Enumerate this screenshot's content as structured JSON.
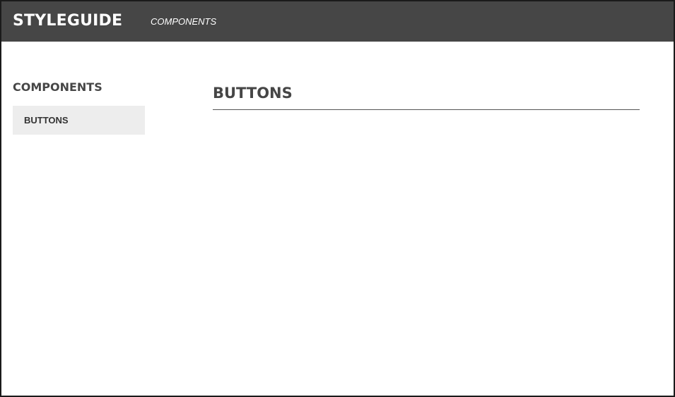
{
  "header": {
    "brand": "STYLEGUIDE",
    "nav_link": "COMPONENTS",
    "background_color": "#464646"
  },
  "sidebar": {
    "heading": "COMPONENTS",
    "items": [
      {
        "label": "BUTTONS",
        "active": true
      }
    ]
  },
  "main": {
    "title": "BUTTONS"
  }
}
